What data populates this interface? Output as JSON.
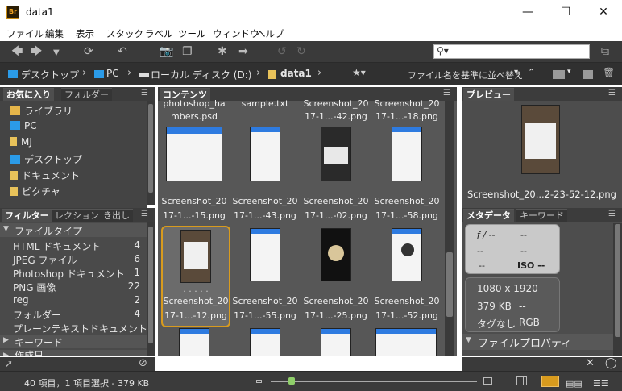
{
  "window": {
    "title": "data1",
    "app_icon": "Br"
  },
  "menu": [
    "ファイル",
    "編集",
    "表示",
    "スタック",
    "ラベル",
    "ツール",
    "ウィンドウ",
    "ヘルプ"
  ],
  "search": {
    "value": "",
    "placeholder": ""
  },
  "path": {
    "items": [
      "デスクトップ",
      "PC",
      "ローカル ディスク (D:)",
      "data1"
    ],
    "sort_label": "ファイル名を基準に並べ替え"
  },
  "left_panel": {
    "tabs": [
      "お気に入り",
      "フォルダー"
    ],
    "favorites": [
      "ライブラリ",
      "PC",
      "MJ",
      "デスクトップ",
      "ドキュメント",
      "ピクチャ"
    ]
  },
  "filter_panel": {
    "tabs": [
      "フィルター",
      "レクション",
      "き出し"
    ],
    "group_file_type": "ファイルタイプ",
    "rows": [
      {
        "name": "HTML ドキュメント",
        "count": "4"
      },
      {
        "name": "JPEG ファイル",
        "count": "6"
      },
      {
        "name": "Photoshop ドキュメント",
        "count": "1"
      },
      {
        "name": "PNG 画像",
        "count": "22"
      },
      {
        "name": "reg",
        "count": "2"
      },
      {
        "name": "フォルダー",
        "count": "4"
      },
      {
        "name": "プレーンテキストドキュメント",
        "count": ""
      }
    ],
    "group_keyword": "キーワード",
    "group_created": "作成日"
  },
  "content": {
    "tab": "コンテンツ",
    "top_row": [
      {
        "l1": "photoshop_ha",
        "l2": "mbers.psd"
      },
      {
        "l1": "sample.txt",
        "l2": ""
      },
      {
        "l1": "Screenshot_20",
        "l2": "17-1...-42.png"
      },
      {
        "l1": "Screenshot_20",
        "l2": "17-1...-18.png"
      }
    ],
    "row2": [
      {
        "l1": "Screenshot_20",
        "l2": "17-1...-15.png"
      },
      {
        "l1": "Screenshot_20",
        "l2": "17-1...-43.png"
      },
      {
        "l1": "Screenshot_20",
        "l2": "17-1...-02.png"
      },
      {
        "l1": "Screenshot_20",
        "l2": "17-1...-58.png"
      }
    ],
    "row3": [
      {
        "l1": "Screenshot_20",
        "l2": "17-1...-12.png"
      },
      {
        "l1": "Screenshot_20",
        "l2": "17-1...-55.png"
      },
      {
        "l1": "Screenshot_20",
        "l2": "17-1...-25.png"
      },
      {
        "l1": "Screenshot_20",
        "l2": "17-1...-52.png"
      }
    ],
    "dots": ". . . . ."
  },
  "preview_panel": {
    "tab": "プレビュー",
    "caption": "Screenshot_20...2-23-52-12.png"
  },
  "meta_panel": {
    "tabs": [
      "メタデータ",
      "キーワード"
    ],
    "fstop": "ƒ / --",
    "r1": "--",
    "r2a": "--",
    "r2b": "--",
    "iso": "ISO --",
    "dims": "1080 x 1920",
    "size": "379 KB",
    "size_v": "--",
    "tags": "タグなし",
    "colormode": "RGB",
    "file_props": "ファイルプロパティ"
  },
  "status": {
    "text": "40 項目，1 項目選択 - 379 KB",
    "zoom_fraction": 0.1
  },
  "colors": {
    "accent": "#d89b1e",
    "panel": "#4a4a4a",
    "blue": "#2e7be0"
  }
}
